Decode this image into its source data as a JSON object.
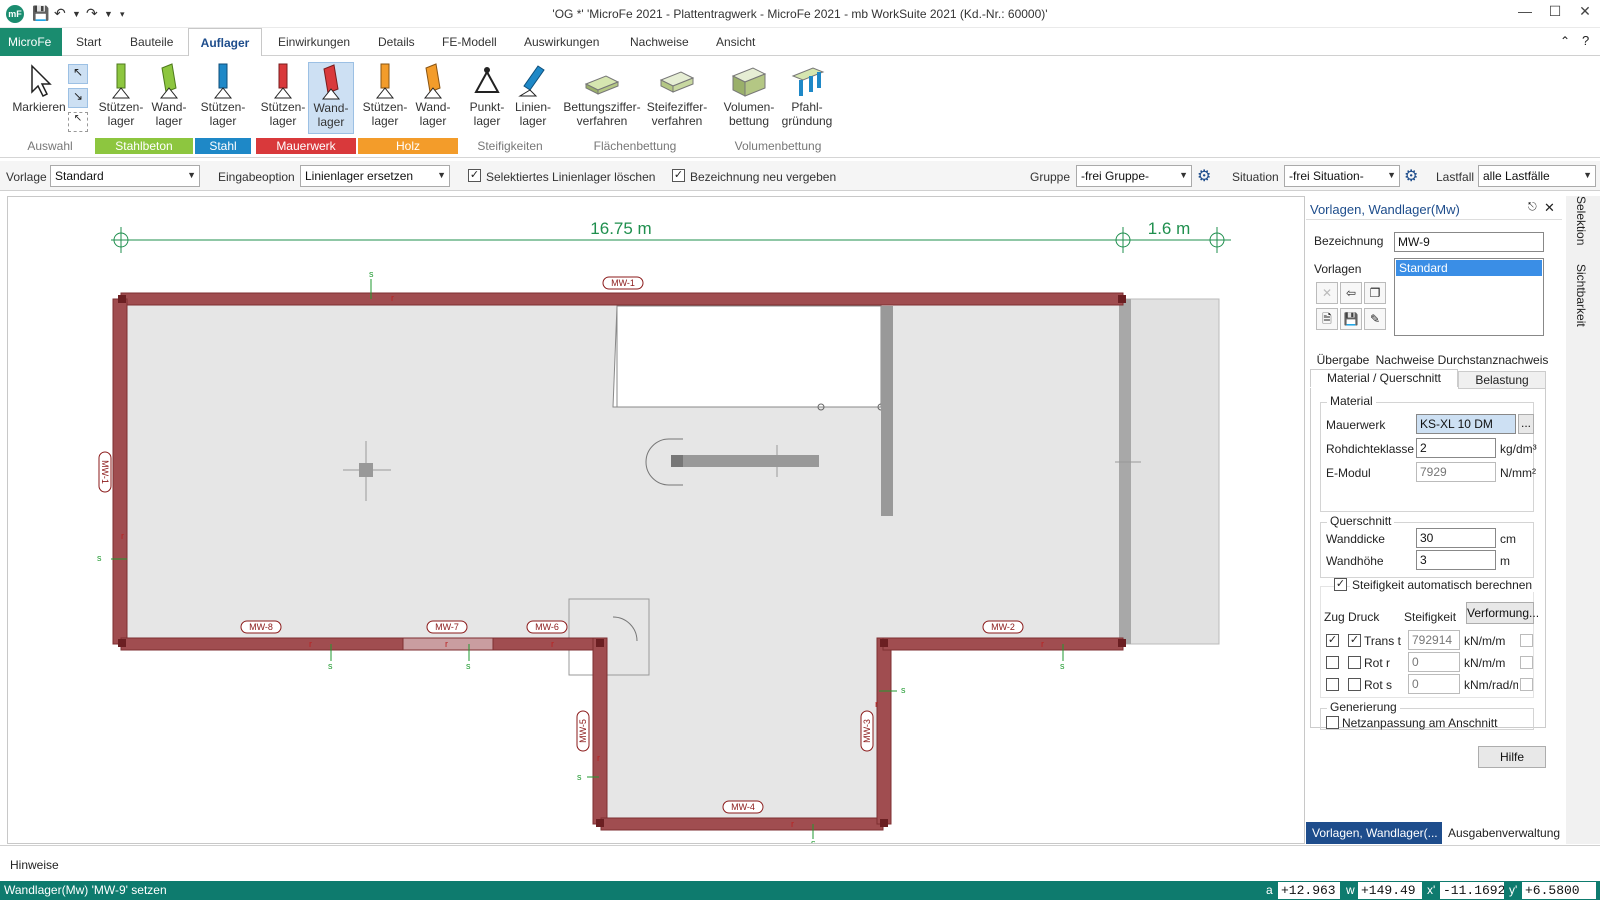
{
  "titlebar": {
    "text": "'OG *' 'MicroFe 2021 -  Plattentragwerk - MicroFe 2021 -  mb WorkSuite 2021 (Kd.-Nr.: 60000)'"
  },
  "menu": {
    "app": "MicroFe",
    "items": [
      "Start",
      "Bauteile",
      "Auflager",
      "Einwirkungen",
      "Details",
      "FE-Modell",
      "Auswirkungen",
      "Nachweise",
      "Ansicht"
    ]
  },
  "ribbon": {
    "markieren": "Markieren",
    "buttons": [
      {
        "l1": "Stützen-",
        "l2": "lager"
      },
      {
        "l1": "Wand-",
        "l2": "lager"
      },
      {
        "l1": "Stützen-",
        "l2": "lager"
      },
      {
        "l1": "Stützen-",
        "l2": "lager"
      },
      {
        "l1": "Wand-",
        "l2": "lager"
      },
      {
        "l1": "Stützen-",
        "l2": "lager"
      },
      {
        "l1": "Wand-",
        "l2": "lager"
      },
      {
        "l1": "Punkt-",
        "l2": "lager"
      },
      {
        "l1": "Linien-",
        "l2": "lager"
      },
      {
        "l1": "Bettungsziffer-",
        "l2": "verfahren"
      },
      {
        "l1": "Steifeziffer-",
        "l2": "verfahren"
      },
      {
        "l1": "Volumen-",
        "l2": "bettung"
      },
      {
        "l1": "Pfahl-",
        "l2": "gründung"
      }
    ],
    "groups": {
      "auswahl": "Auswahl",
      "stahlbeton": "Stahlbeton",
      "stahl": "Stahl",
      "mauerwerk": "Mauerwerk",
      "holz": "Holz",
      "steifigkeiten": "Steifigkeiten",
      "flaechenbettung": "Flächenbettung",
      "volumenbettung": "Volumenbettung"
    },
    "colors": {
      "stahlbeton": "#8dc63f",
      "stahl": "#1e88c7",
      "mauerwerk": "#d9393b",
      "holz": "#f39c2a"
    }
  },
  "options": {
    "vorlage_label": "Vorlage",
    "vorlage_value": "Standard",
    "eingabe_label": "Eingabeoption",
    "eingabe_value": "Linienlager ersetzen",
    "chk1": "Selektiertes Linienlager löschen",
    "chk2": "Bezeichnung neu vergeben",
    "gruppe_label": "Gruppe",
    "gruppe_value": "-frei Gruppe-",
    "situation_label": "Situation",
    "situation_value": "-frei Situation-",
    "lastfall_label": "Lastfall",
    "lastfall_value": "alle Lastfälle"
  },
  "drawing": {
    "dim1": "16.75 m",
    "dim2": "1.6 m",
    "walls": [
      "MW-1",
      "MW-2",
      "MW-3",
      "MW-4",
      "MW-5",
      "MW-6",
      "MW-7",
      "MW-8",
      "MW-1"
    ],
    "r": "r",
    "s": "s"
  },
  "panel": {
    "title": "Vorlagen, Wandlager(Mw)",
    "bezeichnung_label": "Bezeichnung",
    "bezeichnung_value": "MW-9",
    "vorlagen_label": "Vorlagen",
    "vorlagen_item": "Standard",
    "tabs_row1": [
      "Übergabe",
      "Nachweise",
      "Durchstanznachweis"
    ],
    "tabs_row2": [
      "Material / Querschnitt",
      "Belastung"
    ],
    "material": {
      "legend": "Material",
      "mauerwerk_label": "Mauerwerk",
      "mauerwerk_value": "KS-XL 10 DM",
      "browse": "...",
      "rohdichte_label": "Rohdichteklasse",
      "rohdichte_value": "2",
      "rohdichte_unit": "kg/dm³",
      "emodul_label": "E-Modul",
      "emodul_value": "7929",
      "emodul_unit": "N/mm²"
    },
    "querschnitt": {
      "legend": "Querschnitt",
      "wanddicke_label": "Wanddicke",
      "wanddicke_value": "30",
      "wanddicke_unit": "cm",
      "wandhoehe_label": "Wandhöhe",
      "wandhoehe_value": "3",
      "wandhoehe_unit": "m"
    },
    "steifigkeit_auto": "Steifigkeit automatisch berechnen",
    "stiff": {
      "zug_druck": "Zug Druck",
      "steifigkeit": "Steifigkeit",
      "verformung": "Verformung...",
      "rows": [
        {
          "label": "Trans t",
          "value": "792914",
          "unit": "kN/m/m"
        },
        {
          "label": "Rot r",
          "value": "0",
          "unit": "kN/m/m"
        },
        {
          "label": "Rot s",
          "value": "0",
          "unit": "kNm/rad/m"
        }
      ]
    },
    "generierung": {
      "legend": "Generierung",
      "netz": "Netzanpassung am Anschnitt"
    },
    "hilfe": "Hilfe",
    "bottom_tabs": [
      "Vorlagen, Wandlager(...",
      "Ausgabenverwaltung"
    ]
  },
  "sidetabs": [
    "Selektion",
    "Sichtbarkeit"
  ],
  "hinweise": "Hinweise",
  "status": {
    "text": "Wandlager(Mw) 'MW-9' setzen",
    "a_label": "a",
    "a": "+12.963",
    "w_label": "w",
    "w": "+149.49",
    "x_label": "x'",
    "x": "-11.1692",
    "y_label": "y'",
    "y": "+6.5800"
  }
}
